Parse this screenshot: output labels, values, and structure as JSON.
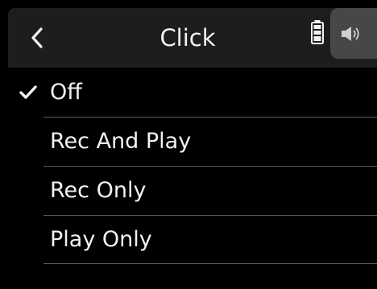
{
  "header": {
    "title": "Click",
    "back_icon": "chevron-left-icon",
    "battery_icon": "battery-icon",
    "speaker_icon": "speaker-icon"
  },
  "menu": {
    "selected_index": 0,
    "items": [
      {
        "label": "Off",
        "selected": true
      },
      {
        "label": "Rec And Play",
        "selected": false
      },
      {
        "label": "Rec Only",
        "selected": false
      },
      {
        "label": "Play Only",
        "selected": false
      }
    ]
  },
  "colors": {
    "background": "#000000",
    "header_background": "#1d1d1d",
    "speaker_tab": "#474747",
    "text": "#f2f2f2",
    "divider": "#5a5a5a"
  }
}
